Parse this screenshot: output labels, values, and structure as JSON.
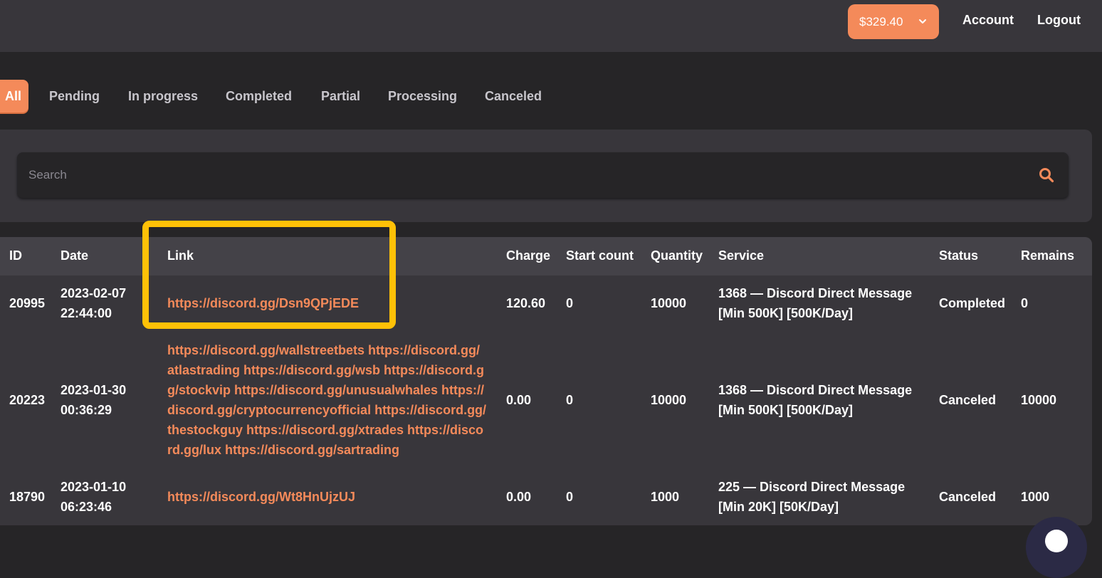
{
  "header": {
    "balance": "$329.40",
    "account_label": "Account",
    "logout_label": "Logout"
  },
  "tabs": [
    "All",
    "Pending",
    "In progress",
    "Completed",
    "Partial",
    "Processing",
    "Canceled"
  ],
  "search": {
    "placeholder": "Search"
  },
  "table": {
    "columns": [
      "ID",
      "Date",
      "Link",
      "Charge",
      "Start count",
      "Quantity",
      "Service",
      "Status",
      "Remains"
    ],
    "rows": [
      {
        "id": "20995",
        "date": "2023-02-07",
        "time": "22:44:00",
        "link": "https://discord.gg/Dsn9QPjEDE",
        "charge": "120.60",
        "start_count": "0",
        "quantity": "10000",
        "service_line1": "1368 — Discord Direct Message",
        "service_line2": "[Min 500K] [500K/Day]",
        "status": "Completed",
        "remains": "0"
      },
      {
        "id": "20223",
        "date": "2023-01-30",
        "time": "00:36:29",
        "link_lines": [
          "https://discord.gg/wallstreetbets https://discord.gg/",
          "atlastrading https://discord.gg/wsb https://discord.g",
          "g/stockvip https://discord.gg/unusualwhales https://",
          "discord.gg/cryptocurrencyofficial https://discord.gg/",
          "thestockguy https://discord.gg/xtrades https://disco",
          "rd.gg/lux https://discord.gg/sartrading"
        ],
        "charge": "0.00",
        "start_count": "0",
        "quantity": "10000",
        "service_line1": "1368 — Discord Direct Message",
        "service_line2": "[Min 500K] [500K/Day]",
        "status": "Canceled",
        "remains": "10000"
      },
      {
        "id": "18790",
        "date": "2023-01-10",
        "time": "06:23:46",
        "link": "https://discord.gg/Wt8HnUjzUJ",
        "charge": "0.00",
        "start_count": "0",
        "quantity": "1000",
        "service_line1": "225 — Discord Direct Message",
        "service_line2": "[Min 20K] [50K/Day]",
        "status": "Canceled",
        "remains": "1000"
      }
    ]
  },
  "colors": {
    "accent": "#f48a5a",
    "highlight": "#ffc107",
    "background": "#262527",
    "card": "#38363b"
  },
  "icons": [
    "chevron-down-icon",
    "search-icon",
    "chat-icon"
  ]
}
